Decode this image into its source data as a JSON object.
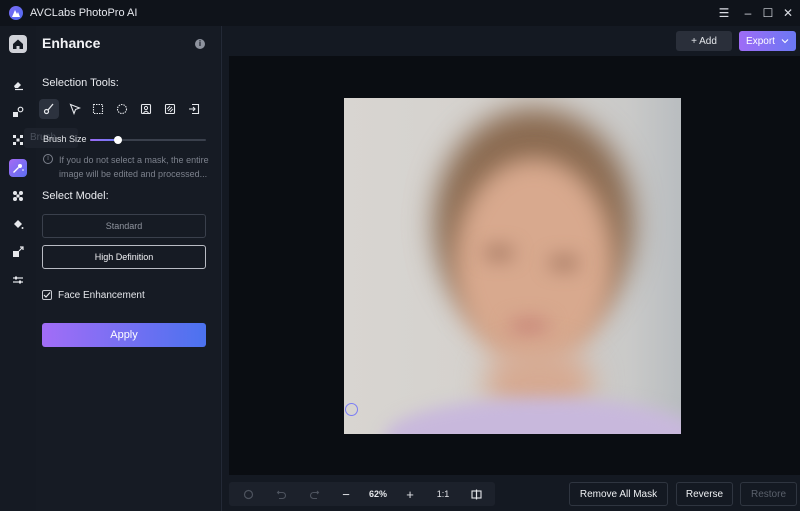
{
  "app": {
    "title": "AVCLabs PhotoPro AI"
  },
  "window_controls": {
    "menu": "☰",
    "minimize": "–",
    "maximize": "☐",
    "close": "✕"
  },
  "rail": {
    "items": [
      {
        "name": "home",
        "icon": "home-icon"
      },
      {
        "name": "eraser",
        "icon": "eraser-icon"
      },
      {
        "name": "replace",
        "icon": "replace-icon"
      },
      {
        "name": "pixel",
        "icon": "pixel-icon"
      },
      {
        "name": "enhance",
        "icon": "enhance-icon",
        "active": true
      },
      {
        "name": "ai-art",
        "icon": "sparkle-icon"
      },
      {
        "name": "colorize",
        "icon": "paint-bucket-icon"
      },
      {
        "name": "upscale",
        "icon": "upscale-icon"
      },
      {
        "name": "adjust",
        "icon": "sliders-icon"
      }
    ]
  },
  "panel": {
    "title": "Enhance",
    "selection_tools_label": "Selection Tools:",
    "tools": [
      {
        "name": "brush",
        "icon": "brush-icon",
        "active": true
      },
      {
        "name": "pointer",
        "icon": "pointer-icon"
      },
      {
        "name": "rect-select",
        "icon": "rect-select-icon"
      },
      {
        "name": "ellipse-select",
        "icon": "ellipse-select-icon"
      },
      {
        "name": "portrait-select",
        "icon": "portrait-icon"
      },
      {
        "name": "background-select",
        "icon": "background-icon"
      },
      {
        "name": "import-mask",
        "icon": "import-icon"
      }
    ],
    "tooltip": "Brush",
    "brush_size_label": "Brush Size",
    "brush_size_value": 0.24,
    "hint": "If you do not select a mask, the entire image will be edited and processed...",
    "select_model_label": "Select Model:",
    "models": [
      "Standard",
      "High Definition"
    ],
    "selected_model": "High Definition",
    "face_enhancement_label": "Face Enhancement",
    "face_enhancement_checked": true,
    "apply_label": "Apply"
  },
  "toolbar": {
    "add_label": "+ Add",
    "export_label": "Export",
    "export_caret": "⌄"
  },
  "bottom_bar": {
    "zoom_value": "62%",
    "minus": "−",
    "plus": "+",
    "one_to_one": "1:1"
  },
  "actions": {
    "remove_all_mask": "Remove All Mask",
    "reverse": "Reverse",
    "restore": "Restore"
  },
  "colors": {
    "accent_start": "#a26df6",
    "accent_end": "#4b72ef",
    "background": "#141922",
    "canvas": "#0a0d12"
  }
}
